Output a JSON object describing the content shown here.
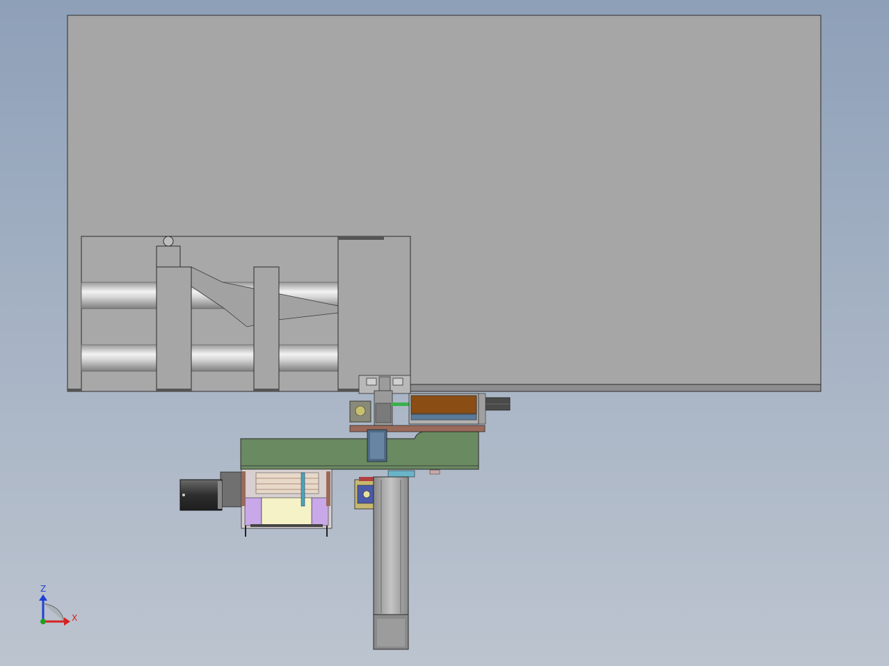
{
  "viewport": {
    "background_top": "#8ea0b8",
    "background_bottom": "#bcc4cf"
  },
  "model": {
    "part_gray": "#a6a6a6",
    "edge_color": "#2b2b2b",
    "base_plate_color": "#6a8a62",
    "motor_color": "#3c3c3c",
    "brown_block_color": "#8a4e14",
    "violet_color": "#c8a8e8",
    "cream_color": "#f6f2c8",
    "copper_color": "#9a6a5a",
    "teal_color": "#4aa6b8",
    "column_color": "#a8a8a8"
  },
  "triad": {
    "z_label": "Z",
    "x_label": "X",
    "z_color": "#1f3fd8",
    "x_color": "#d82020",
    "y_color": "#20a020"
  }
}
